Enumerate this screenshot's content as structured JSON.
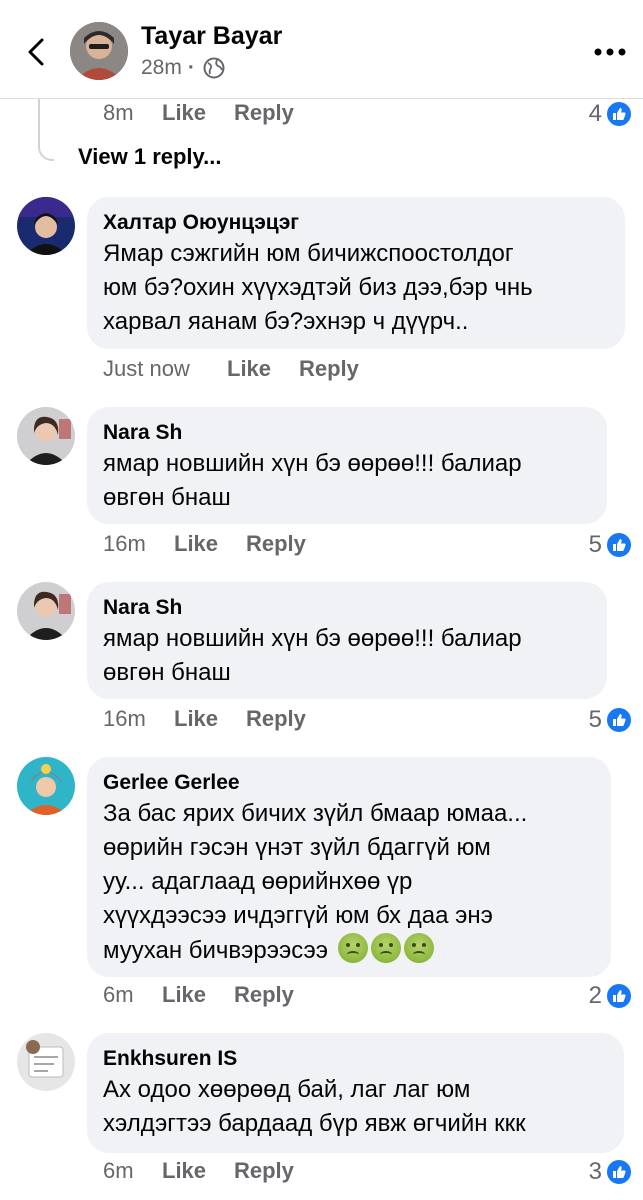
{
  "header": {
    "author_name": "Tayar Bayar",
    "post_time": "28m",
    "visibility_icon": "globe-icon"
  },
  "top_row": {
    "time": "8m",
    "like": "Like",
    "reply": "Reply",
    "reactions": "4"
  },
  "view_replies": "View 1 reply...",
  "comments": [
    {
      "name": "Халтар Оюунцэцэг",
      "text": "Ямар сэжгийн юм бичижспоостолдог\nюм бэ?охин хүүхэдтэй биз дээ,бэр чнь\nхарвал яанам бэ?эхнэр ч дүүрч..",
      "time": "Just now",
      "like": "Like",
      "reply": "Reply",
      "reactions": ""
    },
    {
      "name": "Nara Sh",
      "text": "ямар новшийн хүн бэ өөрөө!!! балиар\nөвгөн бнаш",
      "time": "16m",
      "like": "Like",
      "reply": "Reply",
      "reactions": "5"
    },
    {
      "name": "Nara Sh",
      "text": "ямар новшийн хүн бэ өөрөө!!! балиар\nөвгөн бнаш",
      "time": "16m",
      "like": "Like",
      "reply": "Reply",
      "reactions": "5"
    },
    {
      "name": "Gerlee Gerlee",
      "text": "За бас ярих бичих зүйл бмаар юмаа...\nөөрийн гэсэн үнэт зүйл бдаггүй юм\nуу... адаглаад өөрийнхөө үр\nхүүхдээсээ ичдэггүй юм бх даа энэ\nмуухан бичвэрээсээ",
      "time": "6m",
      "like": "Like",
      "reply": "Reply",
      "reactions": "2"
    },
    {
      "name": "Enkhsuren IS",
      "text": "Ах одоо хөөрөөд бай, лаг лаг юм\nхэлдэгтээ бардаад бүр явж өгчийн ккк",
      "time": "6m",
      "like": "Like",
      "reply": "Reply",
      "reactions": "3"
    }
  ]
}
